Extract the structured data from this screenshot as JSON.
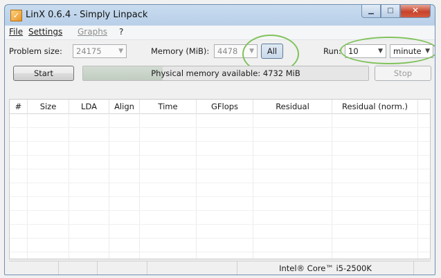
{
  "window": {
    "title": "LinX 0.6.4 - Simply Linpack",
    "app_icon": "checkmark-icon",
    "minimize_glyph": "▁",
    "maximize_glyph": "□",
    "close_glyph": "✕"
  },
  "menu": {
    "file": "File",
    "settings": "Settings",
    "graphs": "Graphs",
    "help": "?"
  },
  "controls": {
    "problem_size_label": "Problem size:",
    "problem_size_value": "24175",
    "memory_label": "Memory (MiB):",
    "memory_value": "4478",
    "all_button": "All",
    "run_label": "Run:",
    "run_value": "10",
    "run_unit": "minute",
    "start_button": "Start",
    "stop_button": "Stop",
    "status_text": "Physical memory available: 4732 MiB",
    "memory_fill_fraction": 0.28
  },
  "table": {
    "columns": [
      "#",
      "Size",
      "LDA",
      "Align",
      "Time",
      "GFlops",
      "Residual",
      "Residual (norm.)"
    ],
    "rows": []
  },
  "statusbar": {
    "cpu": "Intel® Core™ i5-2500K"
  },
  "colors": {
    "highlight_ring": "#7fc25a",
    "close_button": "#c7432b"
  }
}
